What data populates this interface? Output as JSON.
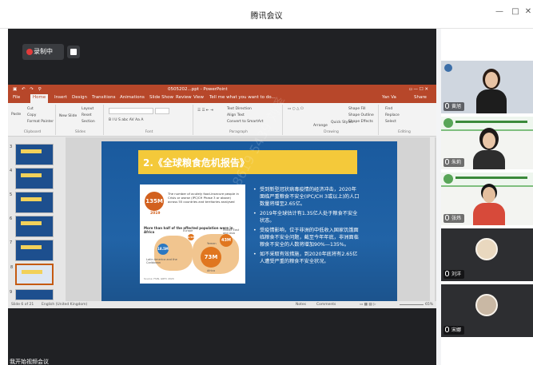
{
  "app": {
    "title": "腾讯会议"
  },
  "recording": {
    "label": "录制中"
  },
  "ppt": {
    "file_title": "0505202...ppt - PowerPoint",
    "search_hint": "Tell me what you want to do...",
    "user": "Yan Va",
    "share_label": "Share",
    "tabs": [
      "File",
      "Home",
      "Insert",
      "Design",
      "Transitions",
      "Animations",
      "Slide Show",
      "Review",
      "View"
    ],
    "ribbon": {
      "clipboard": {
        "paste": "Paste",
        "cut": "Cut",
        "copy": "Copy",
        "format_painter": "Format Painter",
        "group": "Clipboard"
      },
      "slides": {
        "new_slide": "New Slide",
        "layout": "Layout",
        "reset": "Reset",
        "section": "Section",
        "group": "Slides"
      },
      "font_group": "Font",
      "paragraph": {
        "text_direction": "Text Direction",
        "align_text": "Align Text",
        "convert": "Convert to SmartArt",
        "group": "Paragraph"
      },
      "drawing": {
        "arrange": "Arrange",
        "quick_styles": "Quick Styles",
        "shape_fill": "Shape Fill",
        "shape_outline": "Shape Outline",
        "shape_effects": "Shape Effects",
        "group": "Drawing"
      },
      "editing": {
        "find": "Find",
        "replace": "Replace",
        "select": "Select",
        "group": "Editing"
      }
    },
    "thumbnail_numbers": [
      "3",
      "4",
      "5",
      "6",
      "7",
      "8",
      "9"
    ],
    "status": {
      "slide_info": "Slide 6 of 21",
      "language": "English (United Kingdom)",
      "notes": "Notes",
      "comments": "Comments",
      "zoom": "65%"
    }
  },
  "slide": {
    "heading": "2.《全球粮食危机报告》",
    "watermark": "#8619 5439 刘泽",
    "infographic": {
      "big_number": "135M",
      "year": "2019",
      "caption": "The number of acutely food-insecure people in Crisis or worse (IPC/CH Phase 3 or above) across 55 countries and territories analysed",
      "subtitle": "More than half of the affected population were in Africa",
      "bubbles": [
        {
          "value": "73M",
          "label": "Africa"
        },
        {
          "value": "43M",
          "label": "Middle East and Asia"
        },
        {
          "value": "18.5M",
          "label": "Latin America and the Caribbean"
        },
        {
          "value": "0.5M",
          "label": "Europe"
        }
      ],
      "yemen_label": "Yemen",
      "source": "Source: FSIN, GRFC 2020"
    },
    "bullets": [
      "受到新型冠状病毒疫情的经济冲击，2020年面临严重粮食不安全(IPC/CH 3或以上)的人口数量将增至2.65亿。",
      "2019年全球估计有1.35亿人处于粮食不安全状态。",
      "受疫情影响，位于非洲的中低收入国家饥饿面临粮食不安全问题，截至今年年底，非洲面临粮食不安全的人数将增加90%—135%。",
      "如不采取有效措施，到2020年底将有2.65亿人遭受严重的粮食不安全状况。"
    ]
  },
  "participants": [
    {
      "name": "黄旭"
    },
    {
      "name": "朱莉"
    },
    {
      "name": "张炜"
    },
    {
      "name": "刘洋"
    },
    {
      "name": "宋娜"
    }
  ],
  "bottom_caption": "我开始视频会议"
}
